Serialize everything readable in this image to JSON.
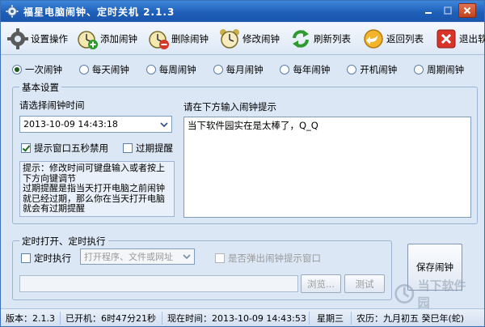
{
  "window": {
    "title": "福星电脑闹钟、定时关机  2.1.3"
  },
  "toolbar": {
    "settings": "设置操作",
    "add": "添加闹钟",
    "delete": "删除闹钟",
    "edit": "修改闹钟",
    "refresh": "刷新列表",
    "back": "返回列表",
    "exit": "退出软件"
  },
  "modes": [
    {
      "label": "一次闹钟",
      "selected": true
    },
    {
      "label": "每天闹钟",
      "selected": false
    },
    {
      "label": "每周闹钟",
      "selected": false
    },
    {
      "label": "每月闹钟",
      "selected": false
    },
    {
      "label": "每年闹钟",
      "selected": false
    },
    {
      "label": "开机闹钟",
      "selected": false
    },
    {
      "label": "周期闹钟",
      "selected": false
    }
  ],
  "basic": {
    "group_label": "基本设置",
    "time_label": "请选择闹钟时间",
    "time_value": "2013-10-09 14:43:18",
    "popup_disable_label": "提示窗口五秒禁用",
    "popup_disable_checked": true,
    "overdue_label": "过期提醒",
    "overdue_checked": false,
    "tips_text": "提示：修改时间可键盘输入或者按上下方向键调节\n过期提醒是指当天打开电脑之前闹钟就已经过期，那么你在当天打开电脑就会有过期提醒",
    "message_label": "请在下方输入闹钟提示",
    "message_text": "当下软件园实在是太棒了，Q_Q"
  },
  "timed": {
    "group_label": "定时打开、定时执行",
    "exec_label": "定时执行",
    "exec_checked": false,
    "target_placeholder": "打开程序、文件或网址",
    "show_popup_label": "是否弹出闹钟提示窗口",
    "path_value": "",
    "browse_label": "浏览...",
    "test_label": "测试"
  },
  "save_label": "保存闹钟",
  "status": {
    "version": "版本：2.1.3",
    "uptime": "已开机：6时47分21秒",
    "now": "现在时间：2013-10-09 14:43:53",
    "weekday": "星期三",
    "lunar": "农历：九月初五  癸巳年(蛇)"
  },
  "watermark": "当下软件园",
  "colors": {
    "titlebar": "#1f5fb8",
    "window_bg": "#dce7f5",
    "close_button": "#c2421e"
  }
}
